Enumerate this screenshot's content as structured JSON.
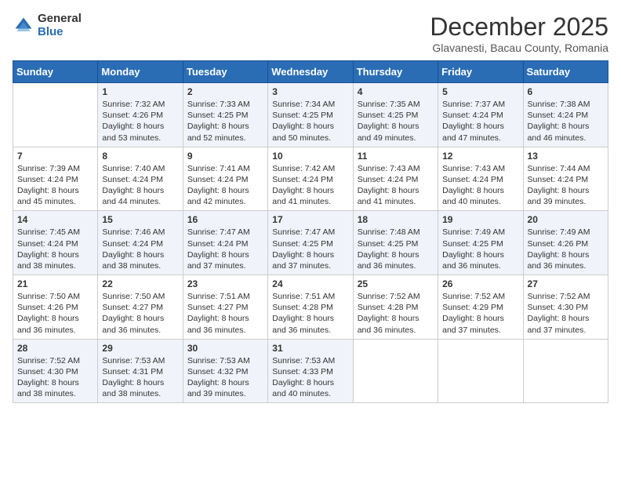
{
  "logo": {
    "general": "General",
    "blue": "Blue"
  },
  "header": {
    "month": "December 2025",
    "location": "Glavanesti, Bacau County, Romania"
  },
  "days_of_week": [
    "Sunday",
    "Monday",
    "Tuesday",
    "Wednesday",
    "Thursday",
    "Friday",
    "Saturday"
  ],
  "weeks": [
    [
      {
        "day": "",
        "sunrise": "",
        "sunset": "",
        "daylight": ""
      },
      {
        "day": "1",
        "sunrise": "Sunrise: 7:32 AM",
        "sunset": "Sunset: 4:26 PM",
        "daylight": "Daylight: 8 hours and 53 minutes."
      },
      {
        "day": "2",
        "sunrise": "Sunrise: 7:33 AM",
        "sunset": "Sunset: 4:25 PM",
        "daylight": "Daylight: 8 hours and 52 minutes."
      },
      {
        "day": "3",
        "sunrise": "Sunrise: 7:34 AM",
        "sunset": "Sunset: 4:25 PM",
        "daylight": "Daylight: 8 hours and 50 minutes."
      },
      {
        "day": "4",
        "sunrise": "Sunrise: 7:35 AM",
        "sunset": "Sunset: 4:25 PM",
        "daylight": "Daylight: 8 hours and 49 minutes."
      },
      {
        "day": "5",
        "sunrise": "Sunrise: 7:37 AM",
        "sunset": "Sunset: 4:24 PM",
        "daylight": "Daylight: 8 hours and 47 minutes."
      },
      {
        "day": "6",
        "sunrise": "Sunrise: 7:38 AM",
        "sunset": "Sunset: 4:24 PM",
        "daylight": "Daylight: 8 hours and 46 minutes."
      }
    ],
    [
      {
        "day": "7",
        "sunrise": "Sunrise: 7:39 AM",
        "sunset": "Sunset: 4:24 PM",
        "daylight": "Daylight: 8 hours and 45 minutes."
      },
      {
        "day": "8",
        "sunrise": "Sunrise: 7:40 AM",
        "sunset": "Sunset: 4:24 PM",
        "daylight": "Daylight: 8 hours and 44 minutes."
      },
      {
        "day": "9",
        "sunrise": "Sunrise: 7:41 AM",
        "sunset": "Sunset: 4:24 PM",
        "daylight": "Daylight: 8 hours and 42 minutes."
      },
      {
        "day": "10",
        "sunrise": "Sunrise: 7:42 AM",
        "sunset": "Sunset: 4:24 PM",
        "daylight": "Daylight: 8 hours and 41 minutes."
      },
      {
        "day": "11",
        "sunrise": "Sunrise: 7:43 AM",
        "sunset": "Sunset: 4:24 PM",
        "daylight": "Daylight: 8 hours and 41 minutes."
      },
      {
        "day": "12",
        "sunrise": "Sunrise: 7:43 AM",
        "sunset": "Sunset: 4:24 PM",
        "daylight": "Daylight: 8 hours and 40 minutes."
      },
      {
        "day": "13",
        "sunrise": "Sunrise: 7:44 AM",
        "sunset": "Sunset: 4:24 PM",
        "daylight": "Daylight: 8 hours and 39 minutes."
      }
    ],
    [
      {
        "day": "14",
        "sunrise": "Sunrise: 7:45 AM",
        "sunset": "Sunset: 4:24 PM",
        "daylight": "Daylight: 8 hours and 38 minutes."
      },
      {
        "day": "15",
        "sunrise": "Sunrise: 7:46 AM",
        "sunset": "Sunset: 4:24 PM",
        "daylight": "Daylight: 8 hours and 38 minutes."
      },
      {
        "day": "16",
        "sunrise": "Sunrise: 7:47 AM",
        "sunset": "Sunset: 4:24 PM",
        "daylight": "Daylight: 8 hours and 37 minutes."
      },
      {
        "day": "17",
        "sunrise": "Sunrise: 7:47 AM",
        "sunset": "Sunset: 4:25 PM",
        "daylight": "Daylight: 8 hours and 37 minutes."
      },
      {
        "day": "18",
        "sunrise": "Sunrise: 7:48 AM",
        "sunset": "Sunset: 4:25 PM",
        "daylight": "Daylight: 8 hours and 36 minutes."
      },
      {
        "day": "19",
        "sunrise": "Sunrise: 7:49 AM",
        "sunset": "Sunset: 4:25 PM",
        "daylight": "Daylight: 8 hours and 36 minutes."
      },
      {
        "day": "20",
        "sunrise": "Sunrise: 7:49 AM",
        "sunset": "Sunset: 4:26 PM",
        "daylight": "Daylight: 8 hours and 36 minutes."
      }
    ],
    [
      {
        "day": "21",
        "sunrise": "Sunrise: 7:50 AM",
        "sunset": "Sunset: 4:26 PM",
        "daylight": "Daylight: 8 hours and 36 minutes."
      },
      {
        "day": "22",
        "sunrise": "Sunrise: 7:50 AM",
        "sunset": "Sunset: 4:27 PM",
        "daylight": "Daylight: 8 hours and 36 minutes."
      },
      {
        "day": "23",
        "sunrise": "Sunrise: 7:51 AM",
        "sunset": "Sunset: 4:27 PM",
        "daylight": "Daylight: 8 hours and 36 minutes."
      },
      {
        "day": "24",
        "sunrise": "Sunrise: 7:51 AM",
        "sunset": "Sunset: 4:28 PM",
        "daylight": "Daylight: 8 hours and 36 minutes."
      },
      {
        "day": "25",
        "sunrise": "Sunrise: 7:52 AM",
        "sunset": "Sunset: 4:28 PM",
        "daylight": "Daylight: 8 hours and 36 minutes."
      },
      {
        "day": "26",
        "sunrise": "Sunrise: 7:52 AM",
        "sunset": "Sunset: 4:29 PM",
        "daylight": "Daylight: 8 hours and 37 minutes."
      },
      {
        "day": "27",
        "sunrise": "Sunrise: 7:52 AM",
        "sunset": "Sunset: 4:30 PM",
        "daylight": "Daylight: 8 hours and 37 minutes."
      }
    ],
    [
      {
        "day": "28",
        "sunrise": "Sunrise: 7:52 AM",
        "sunset": "Sunset: 4:30 PM",
        "daylight": "Daylight: 8 hours and 38 minutes."
      },
      {
        "day": "29",
        "sunrise": "Sunrise: 7:53 AM",
        "sunset": "Sunset: 4:31 PM",
        "daylight": "Daylight: 8 hours and 38 minutes."
      },
      {
        "day": "30",
        "sunrise": "Sunrise: 7:53 AM",
        "sunset": "Sunset: 4:32 PM",
        "daylight": "Daylight: 8 hours and 39 minutes."
      },
      {
        "day": "31",
        "sunrise": "Sunrise: 7:53 AM",
        "sunset": "Sunset: 4:33 PM",
        "daylight": "Daylight: 8 hours and 40 minutes."
      },
      {
        "day": "",
        "sunrise": "",
        "sunset": "",
        "daylight": ""
      },
      {
        "day": "",
        "sunrise": "",
        "sunset": "",
        "daylight": ""
      },
      {
        "day": "",
        "sunrise": "",
        "sunset": "",
        "daylight": ""
      }
    ]
  ]
}
